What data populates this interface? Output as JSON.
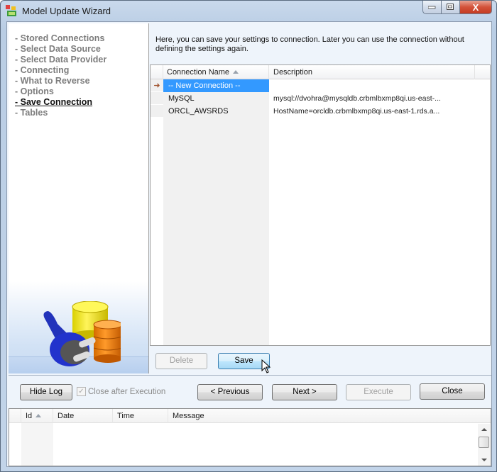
{
  "window": {
    "title": "Model Update Wizard",
    "controls": {
      "minimize": "minimize",
      "maximize": "maximize",
      "close": "X"
    }
  },
  "steps": [
    {
      "label": "- Stored Connections",
      "active": false
    },
    {
      "label": "- Select Data Source",
      "active": false
    },
    {
      "label": "- Select Data Provider",
      "active": false
    },
    {
      "label": "- Connecting",
      "active": false
    },
    {
      "label": "- What to Reverse",
      "active": false
    },
    {
      "label": "- Options",
      "active": false
    },
    {
      "label": "- Save Connection",
      "active": true
    },
    {
      "label": "- Tables",
      "active": false
    }
  ],
  "hint": "Here, you can save your settings to connection. Later you can use the connection without defining the settings again.",
  "connections_grid": {
    "columns": {
      "name": "Connection Name",
      "description": "Description"
    },
    "rows": [
      {
        "name": "-- New Connection --",
        "description": "",
        "selected": true,
        "current_indicator": "➜"
      },
      {
        "name": "MySQL",
        "description": "mysql://dvohra@mysqldb.crbmlbxmp8qi.us-east-...",
        "selected": false,
        "current_indicator": ""
      },
      {
        "name": "ORCL_AWSRDS",
        "description": "HostName=orcldb.crbmlbxmp8qi.us-east-1.rds.a...",
        "selected": false,
        "current_indicator": ""
      }
    ]
  },
  "grid_buttons": {
    "delete": "Delete",
    "save": "Save"
  },
  "footer": {
    "hide_log": "Hide Log",
    "close_after_execution": "Close after Execution",
    "close_after_execution_checked": true,
    "previous": "< Previous",
    "next": "Next >",
    "execute": "Execute",
    "close": "Close"
  },
  "log": {
    "columns": {
      "id": "Id",
      "date": "Date",
      "time": "Time",
      "message": "Message"
    },
    "rows": []
  },
  "colors": {
    "selection": "#3399ff",
    "indicator": "#a0522d"
  }
}
